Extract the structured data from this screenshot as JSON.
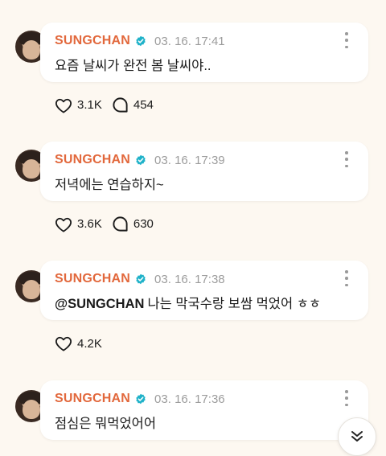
{
  "posts": [
    {
      "author": "SUNGCHAN",
      "time": "03. 16. 17:41",
      "mention": "",
      "text": "요즘 날씨가 완전 봄 날씨야..",
      "likes": "3.1K",
      "comments": "454"
    },
    {
      "author": "SUNGCHAN",
      "time": "03. 16. 17:39",
      "mention": "",
      "text": "저녁에는 연습하지~",
      "likes": "3.6K",
      "comments": "630"
    },
    {
      "author": "SUNGCHAN",
      "time": "03. 16. 17:38",
      "mention": "@SUNGCHAN",
      "text": "나는 막국수랑 보쌈 먹었어 ㅎㅎ",
      "likes": "4.2K",
      "comments": ""
    },
    {
      "author": "SUNGCHAN",
      "time": "03. 16. 17:36",
      "mention": "",
      "text": "점심은 뭐먹었어어",
      "likes": "",
      "comments": ""
    }
  ],
  "colors": {
    "accent": "#e2683c",
    "verified": "#20b2c9",
    "background": "#fdf8f1"
  },
  "icons": {
    "verified": "verified-badge-icon",
    "like": "heart-icon",
    "comment": "comment-bubble-icon",
    "more": "more-options-icon",
    "scroll": "double-chevron-down-icon"
  }
}
